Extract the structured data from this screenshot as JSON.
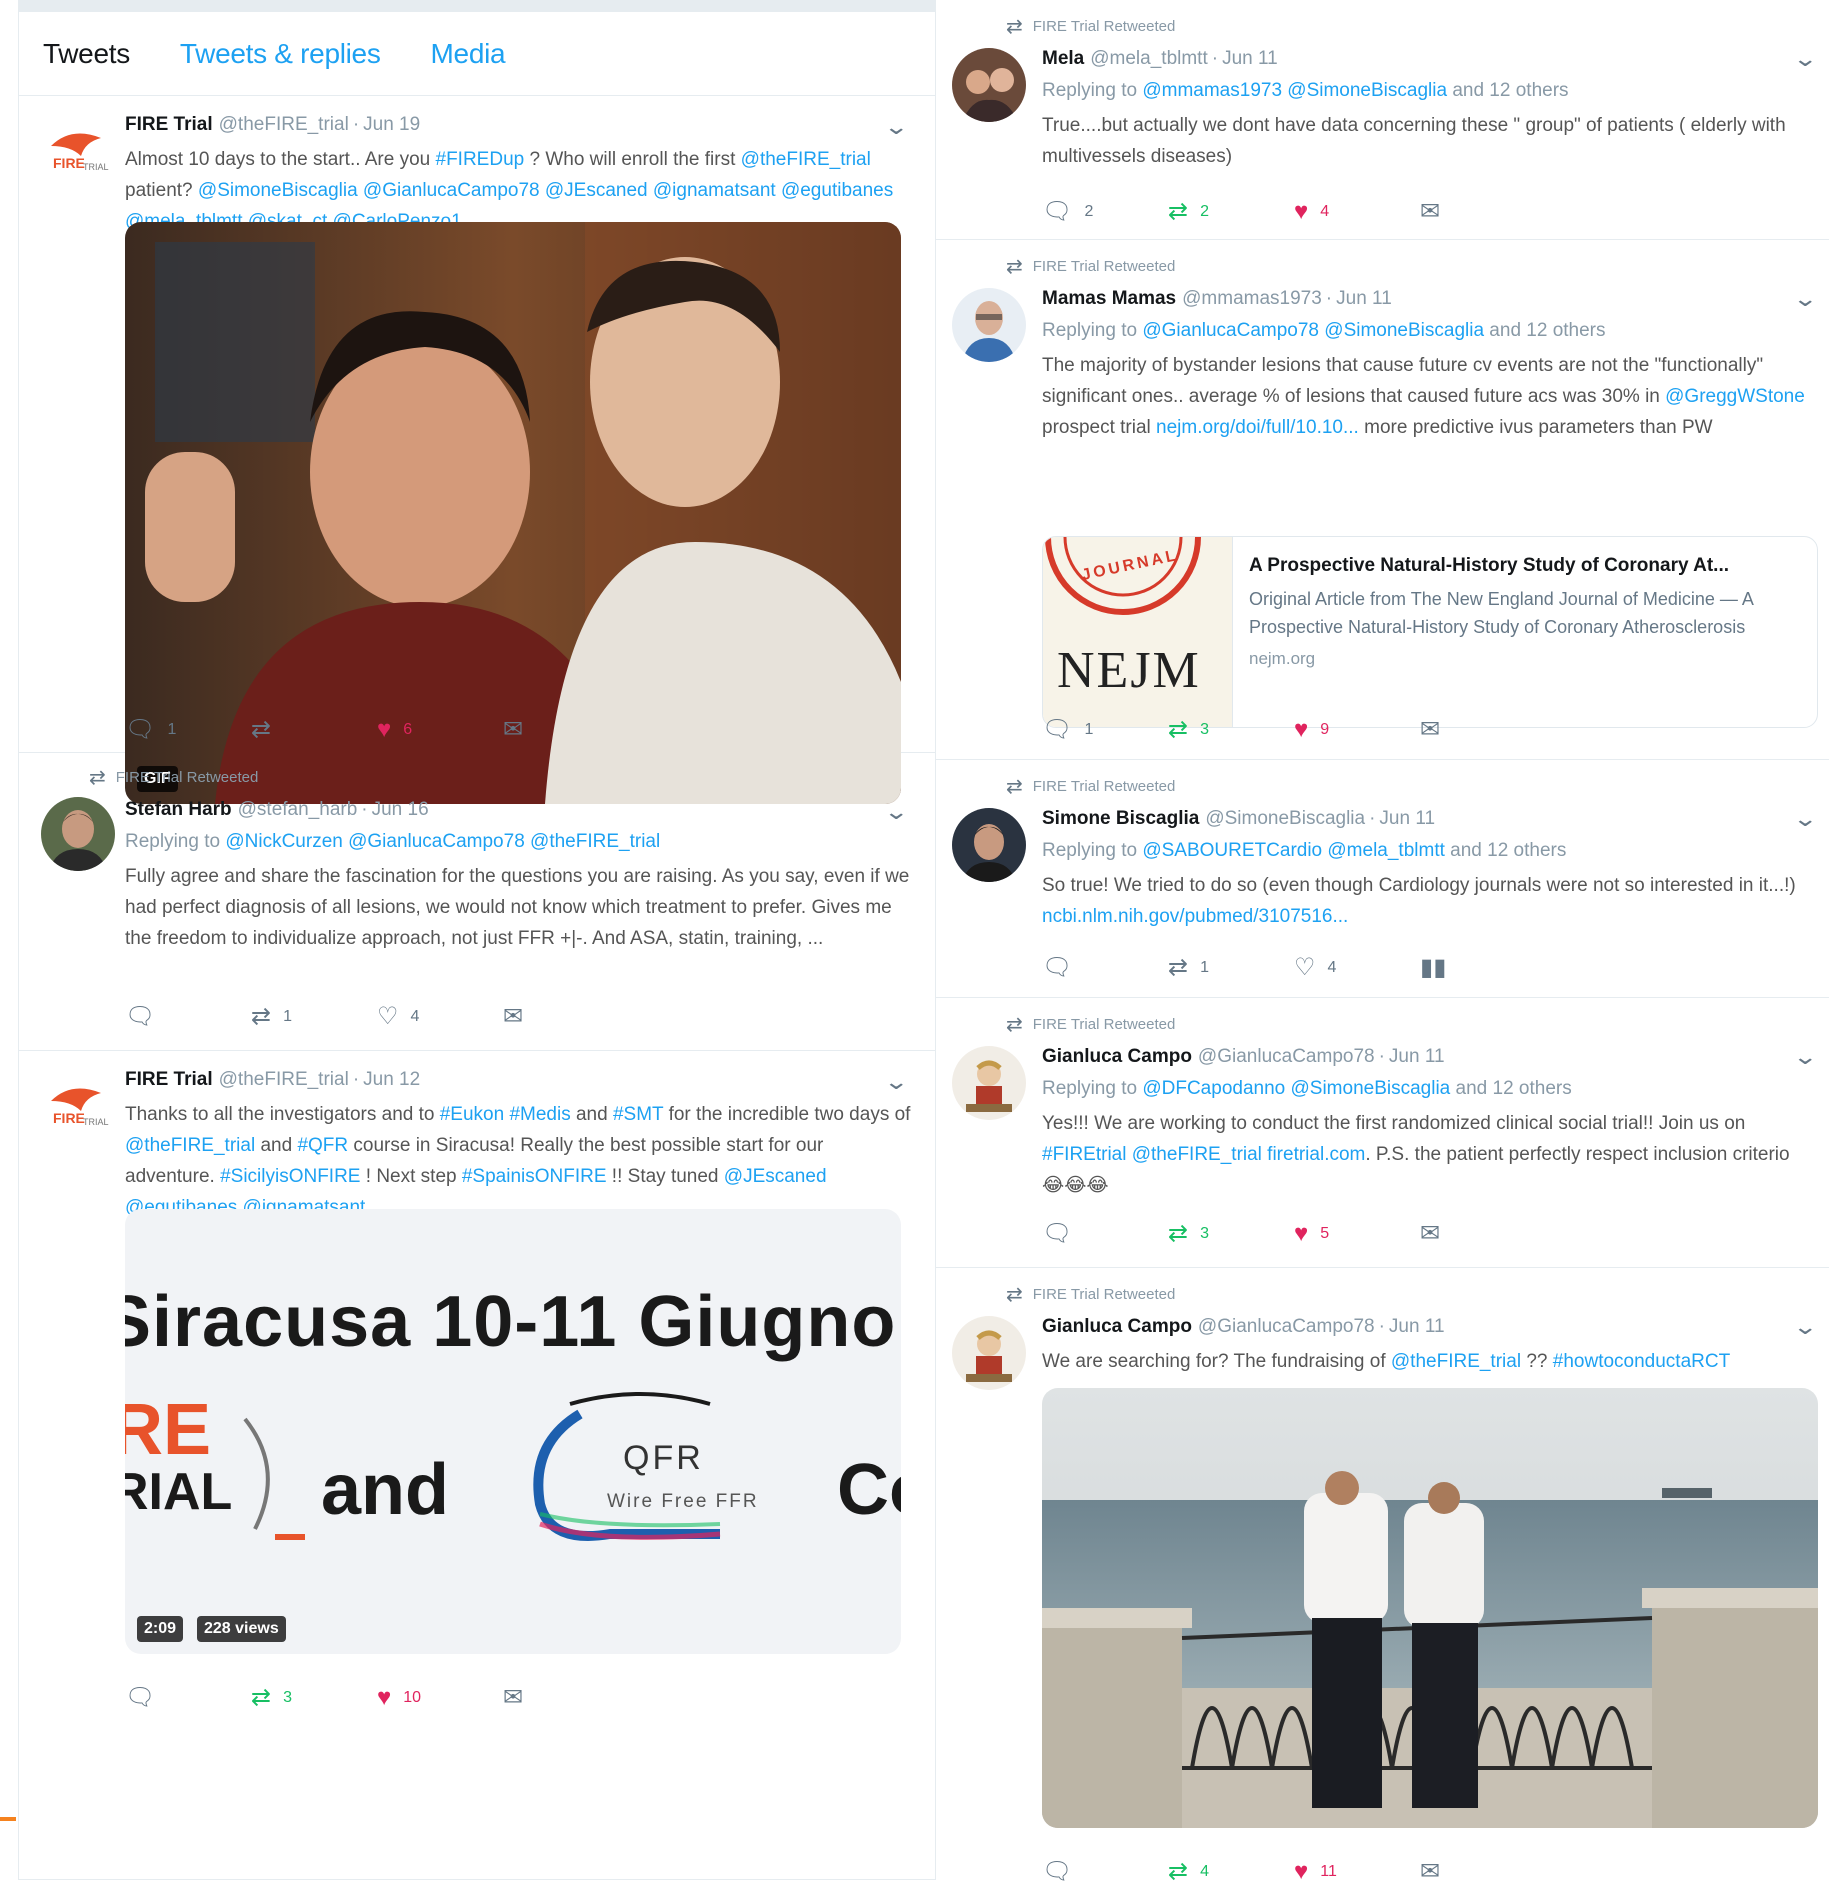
{
  "tabs": [
    "Tweets",
    "Tweets & replies",
    "Media"
  ],
  "retweet_label": "FIRE Trial Retweeted",
  "left": [
    {
      "name": "FIRE Trial",
      "handle": "@theFIRE_trial",
      "date": "Jun 19",
      "text": [
        "Almost 10 days to the start.. Are you ",
        "#FIREDup",
        " ? Who will enroll the first ",
        "@theFIRE_trial",
        " patient? ",
        "@SimoneBiscaglia @GianlucaCampo78 @JEscaned @ignamatsant @egutibanes @mela_tblmtt @skat_ct @CarloPenzo1",
        ""
      ],
      "media_badge": "GIF",
      "replies": "1",
      "retweets": "",
      "likes": "6"
    },
    {
      "name": "Stefan Harb",
      "handle": "@stefan_harb",
      "date": "Jun 16",
      "replying_prefix": "Replying to ",
      "replying_to": "@NickCurzen @GianlucaCampo78 @theFIRE_trial",
      "text": "Fully agree and share the fascination for the questions you are raising. As you say, even if we had perfect diagnosis of all lesions, we would not know which treatment to prefer. Gives me the freedom to individualize approach, not just FFR +|-. And ASA, statin, training, ...",
      "replies": "",
      "retweets": "1",
      "likes": "4"
    },
    {
      "name": "FIRE Trial",
      "handle": "@theFIRE_trial",
      "date": "Jun 12",
      "text": [
        "Thanks to all the investigators and to ",
        "#Eukon #Medis",
        " and ",
        "#SMT",
        " for the incredible two days of ",
        "@theFIRE_trial",
        " and ",
        "#QFR",
        " course in Siracusa! Really the best possible start for our adventure. ",
        "#SicilyisONFIRE",
        " ! Next step ",
        "#SpainisONFIRE",
        " !! Stay tuned ",
        "@JEscaned @egutibanes @ignamatsant",
        ""
      ],
      "slide_title": "Siracusa 10-11 Giugno",
      "slide_fire_1": "RE",
      "slide_fire_2": "RIAL",
      "slide_and": "and",
      "slide_c": "Co",
      "slide_qfr": "QFR",
      "slide_qfr_sub": "Wire Free FFR",
      "media_time": "2:09",
      "media_views": "228 views",
      "replies": "",
      "retweets": "3",
      "likes": "10"
    }
  ],
  "right": [
    {
      "name": "Mela",
      "handle": "@mela_tblmtt",
      "date": "Jun 11",
      "replying_prefix": "Replying to ",
      "replying_to": "@mmamas1973 @SimoneBiscaglia",
      "replying_suffix": " and 12 others",
      "text": "True....but actually we dont have data concerning these \" group\" of patients ( elderly with multivessels diseases)",
      "replies": "2",
      "retweets": "2",
      "likes": "4"
    },
    {
      "name": "Mamas Mamas",
      "handle": "@mmamas1973",
      "date": "Jun 11",
      "replying_prefix": "Replying to ",
      "replying_to": "@GianlucaCampo78 @SimoneBiscaglia",
      "replying_suffix": " and 12 others",
      "text": [
        "The majority of bystander lesions that cause future cv events are not the \"functionally\" significant ones.. average % of lesions that caused future acs was 30% in ",
        "@GreggWStone",
        " prospect trial ",
        "nejm.org/doi/full/10.10...",
        " more predictive ivus parameters than PW"
      ],
      "card_title": "A Prospective Natural-History Study of Coronary At...",
      "card_desc": "Original Article from The New England Journal of Medicine — A Prospective Natural-History Study of Coronary Atherosclerosis",
      "card_site": "nejm.org",
      "card_logo": "NEJM",
      "card_seal": "JOURNAL",
      "replies": "1",
      "retweets": "3",
      "likes": "9"
    },
    {
      "name": "Simone Biscaglia",
      "handle": "@SimoneBiscaglia",
      "date": "Jun 11",
      "replying_prefix": "Replying to ",
      "replying_to": "@SABOURETCardio @mela_tblmtt",
      "replying_suffix": " and 12 others",
      "text": [
        "So true! We tried to do so (even though Cardiology journals were not so interested in it...!) ",
        "ncbi.nlm.nih.gov/pubmed/3107516...",
        ""
      ],
      "replies": "",
      "retweets": "1",
      "likes": "4"
    },
    {
      "name": "Gianluca Campo",
      "handle": "@GianlucaCampo78",
      "date": "Jun 11",
      "replying_prefix": "Replying to ",
      "replying_to": "@DFCapodanno @SimoneBiscaglia",
      "replying_suffix": " and 12 others",
      "text": [
        "Yes!!! We are working to conduct the first randomized clinical social trial!! Join us on ",
        "#FIREtrial @theFIRE_trial firetrial.com",
        ". P.S. the patient perfectly respect inclusion criterio ",
        "",
        ""
      ],
      "emoji": "😂😂😂",
      "replies": "",
      "retweets": "3",
      "likes": "5"
    },
    {
      "name": "Gianluca Campo",
      "handle": "@GianlucaCampo78",
      "date": "Jun 11",
      "text": [
        "We are searching for? The fundraising of ",
        "@theFIRE_trial",
        " ?? ",
        "#howtoconductaRCT",
        ""
      ],
      "replies": "",
      "retweets": "4",
      "likes": "11"
    }
  ],
  "colors": {
    "link": "#1da1f2",
    "retweet": "#17bf63",
    "like": "#e0245e",
    "muted": "#657786"
  }
}
